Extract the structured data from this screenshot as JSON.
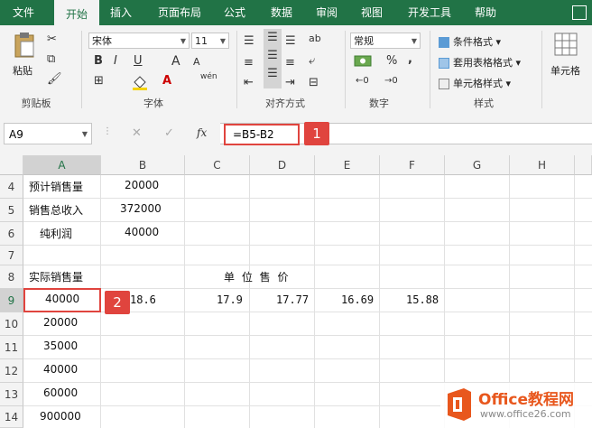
{
  "menu": {
    "tabs": [
      "文件",
      "开始",
      "插入",
      "页面布局",
      "公式",
      "数据",
      "审阅",
      "视图",
      "开发工具",
      "帮助"
    ],
    "active_index": 1
  },
  "ribbon": {
    "clipboard": {
      "paste_label": "粘贴",
      "group_label": "剪贴板"
    },
    "font": {
      "font_name": "宋体",
      "font_size": "11",
      "bold": "B",
      "italic": "I",
      "underline": "U",
      "grow": "A",
      "shrink": "A",
      "wen": "wén",
      "group_label": "字体"
    },
    "alignment": {
      "group_label": "对齐方式"
    },
    "number": {
      "format": "常规",
      "percent": "%",
      "comma": ",",
      "group_label": "数字"
    },
    "styles": {
      "conditional": "条件格式",
      "table": "套用表格格式",
      "cell_styles": "单元格样式",
      "group_label": "样式"
    },
    "cells": {
      "label": "单元格"
    }
  },
  "formula_bar": {
    "name_box": "A9",
    "fx": "fx",
    "formula": "=B5-B2",
    "badge": "1"
  },
  "columns": [
    "A",
    "B",
    "C",
    "D",
    "E",
    "F",
    "G",
    "H"
  ],
  "rows": [
    "4",
    "5",
    "6",
    "7",
    "8",
    "9",
    "10",
    "11",
    "12",
    "13",
    "14"
  ],
  "cells": {
    "a4": "预计销售量",
    "b4": "20000",
    "a5": "销售总收入",
    "b5": "372000",
    "a6": "纯利润",
    "b6": "40000",
    "a8": "实际销售量",
    "unit_price_header": "单  位  售  价",
    "a9": "40000",
    "b9": "18.6",
    "c9": "17.9",
    "d9": "17.77",
    "e9": "16.69",
    "f9": "15.88",
    "a10": "20000",
    "a11": "35000",
    "a12": "40000",
    "a13": "60000",
    "a14": "900000"
  },
  "selection_badge": "2",
  "watermark": {
    "brand": "Office教程网",
    "url": "www.office26.com"
  },
  "colors": {
    "accent": "#217346",
    "highlight": "#e0443e",
    "brand_orange": "#e8571d"
  }
}
